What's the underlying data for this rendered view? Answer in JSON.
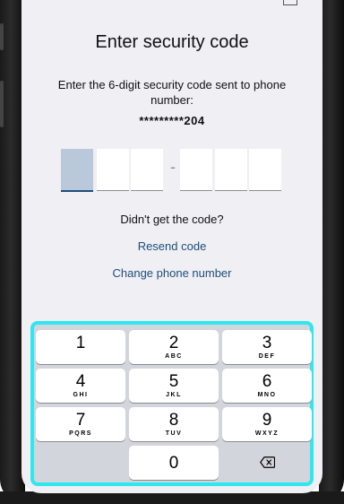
{
  "screen": {
    "title": "Enter security code",
    "subtitle": "Enter the 6-digit security code sent to phone number:",
    "masked_phone": "*********204",
    "code_separator": "-",
    "didnt_get_code": "Didn't get the code?",
    "resend_code": "Resend code",
    "change_phone_number": "Change phone number"
  },
  "keypad": {
    "keys": [
      {
        "digit": "1",
        "letters": ""
      },
      {
        "digit": "2",
        "letters": "ABC"
      },
      {
        "digit": "3",
        "letters": "DEF"
      },
      {
        "digit": "4",
        "letters": "GHI"
      },
      {
        "digit": "5",
        "letters": "JKL"
      },
      {
        "digit": "6",
        "letters": "MNO"
      },
      {
        "digit": "7",
        "letters": "PQRS"
      },
      {
        "digit": "8",
        "letters": "TUV"
      },
      {
        "digit": "9",
        "letters": "WXYZ"
      },
      {
        "digit": "0",
        "letters": ""
      }
    ],
    "backspace_icon": "backspace-icon"
  },
  "colors": {
    "highlight_border": "#2ee8ef",
    "link": "#1f4e79",
    "active_code_box": "#b9c9d9"
  }
}
